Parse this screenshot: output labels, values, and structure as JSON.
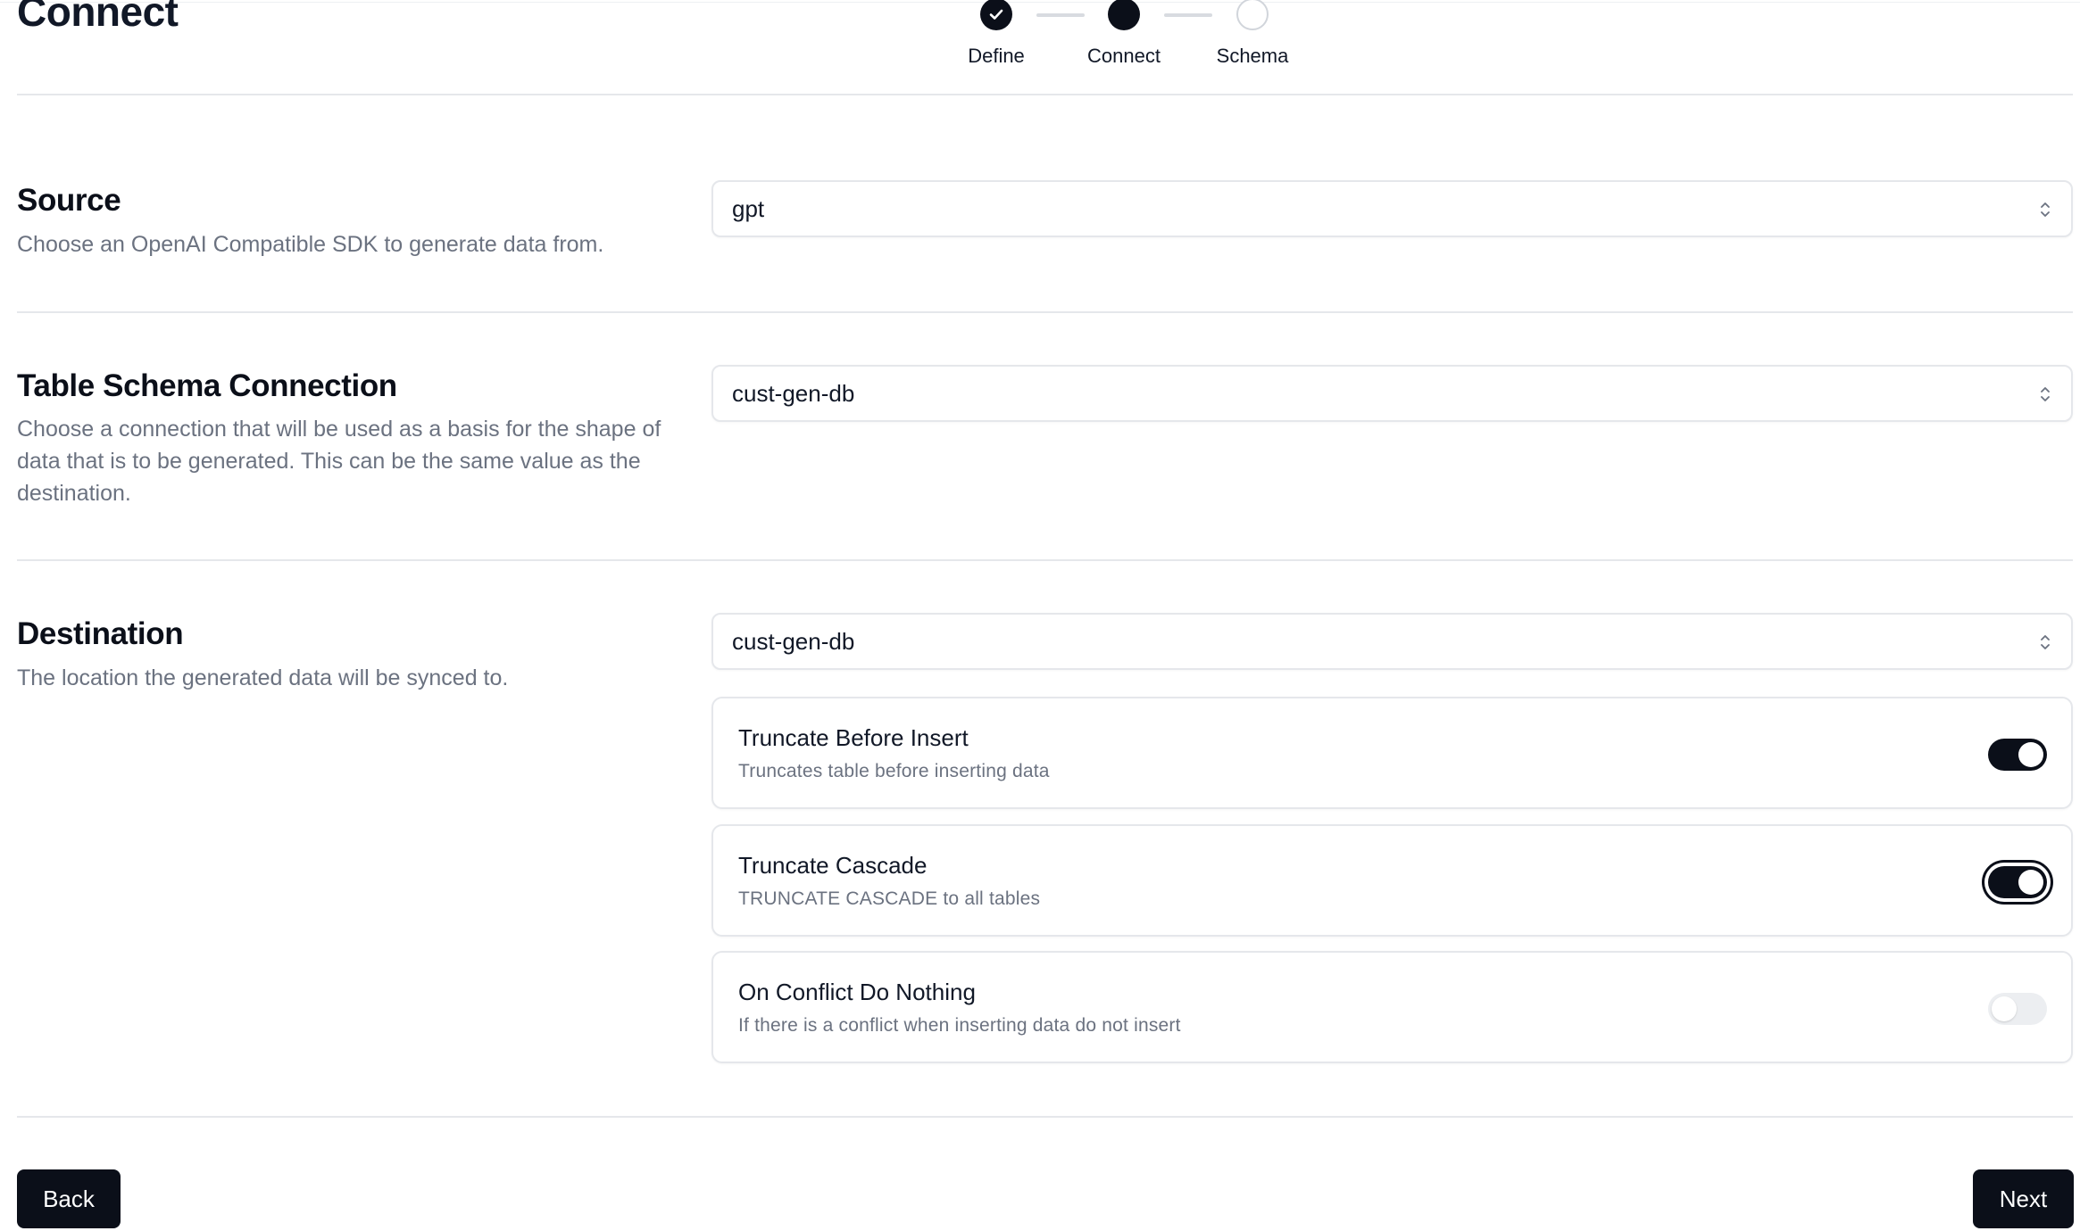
{
  "page": {
    "title": "Connect"
  },
  "stepper": {
    "steps": [
      {
        "label": "Define",
        "state": "done"
      },
      {
        "label": "Connect",
        "state": "active"
      },
      {
        "label": "Schema",
        "state": "pending"
      }
    ]
  },
  "sections": {
    "source": {
      "title": "Source",
      "description": "Choose an OpenAI Compatible SDK to generate data from.",
      "selected": "gpt"
    },
    "schema_connection": {
      "title": "Table Schema Connection",
      "description": "Choose a connection that will be used as a basis for the shape of data that is to be generated. This can be the same value as the destination.",
      "selected": "cust-gen-db"
    },
    "destination": {
      "title": "Destination",
      "description": "The location the generated data will be synced to.",
      "selected": "cust-gen-db",
      "options": [
        {
          "title": "Truncate Before Insert",
          "description": "Truncates table before inserting data",
          "enabled": true
        },
        {
          "title": "Truncate Cascade",
          "description": "TRUNCATE CASCADE to all tables",
          "enabled": true
        },
        {
          "title": "On Conflict Do Nothing",
          "description": "If there is a conflict when inserting data do not insert",
          "enabled": false
        }
      ]
    }
  },
  "footer": {
    "back_label": "Back",
    "next_label": "Next"
  },
  "colors": {
    "primary": "#0b0f19",
    "muted_text": "#6b7280",
    "border": "#e5e7eb"
  }
}
